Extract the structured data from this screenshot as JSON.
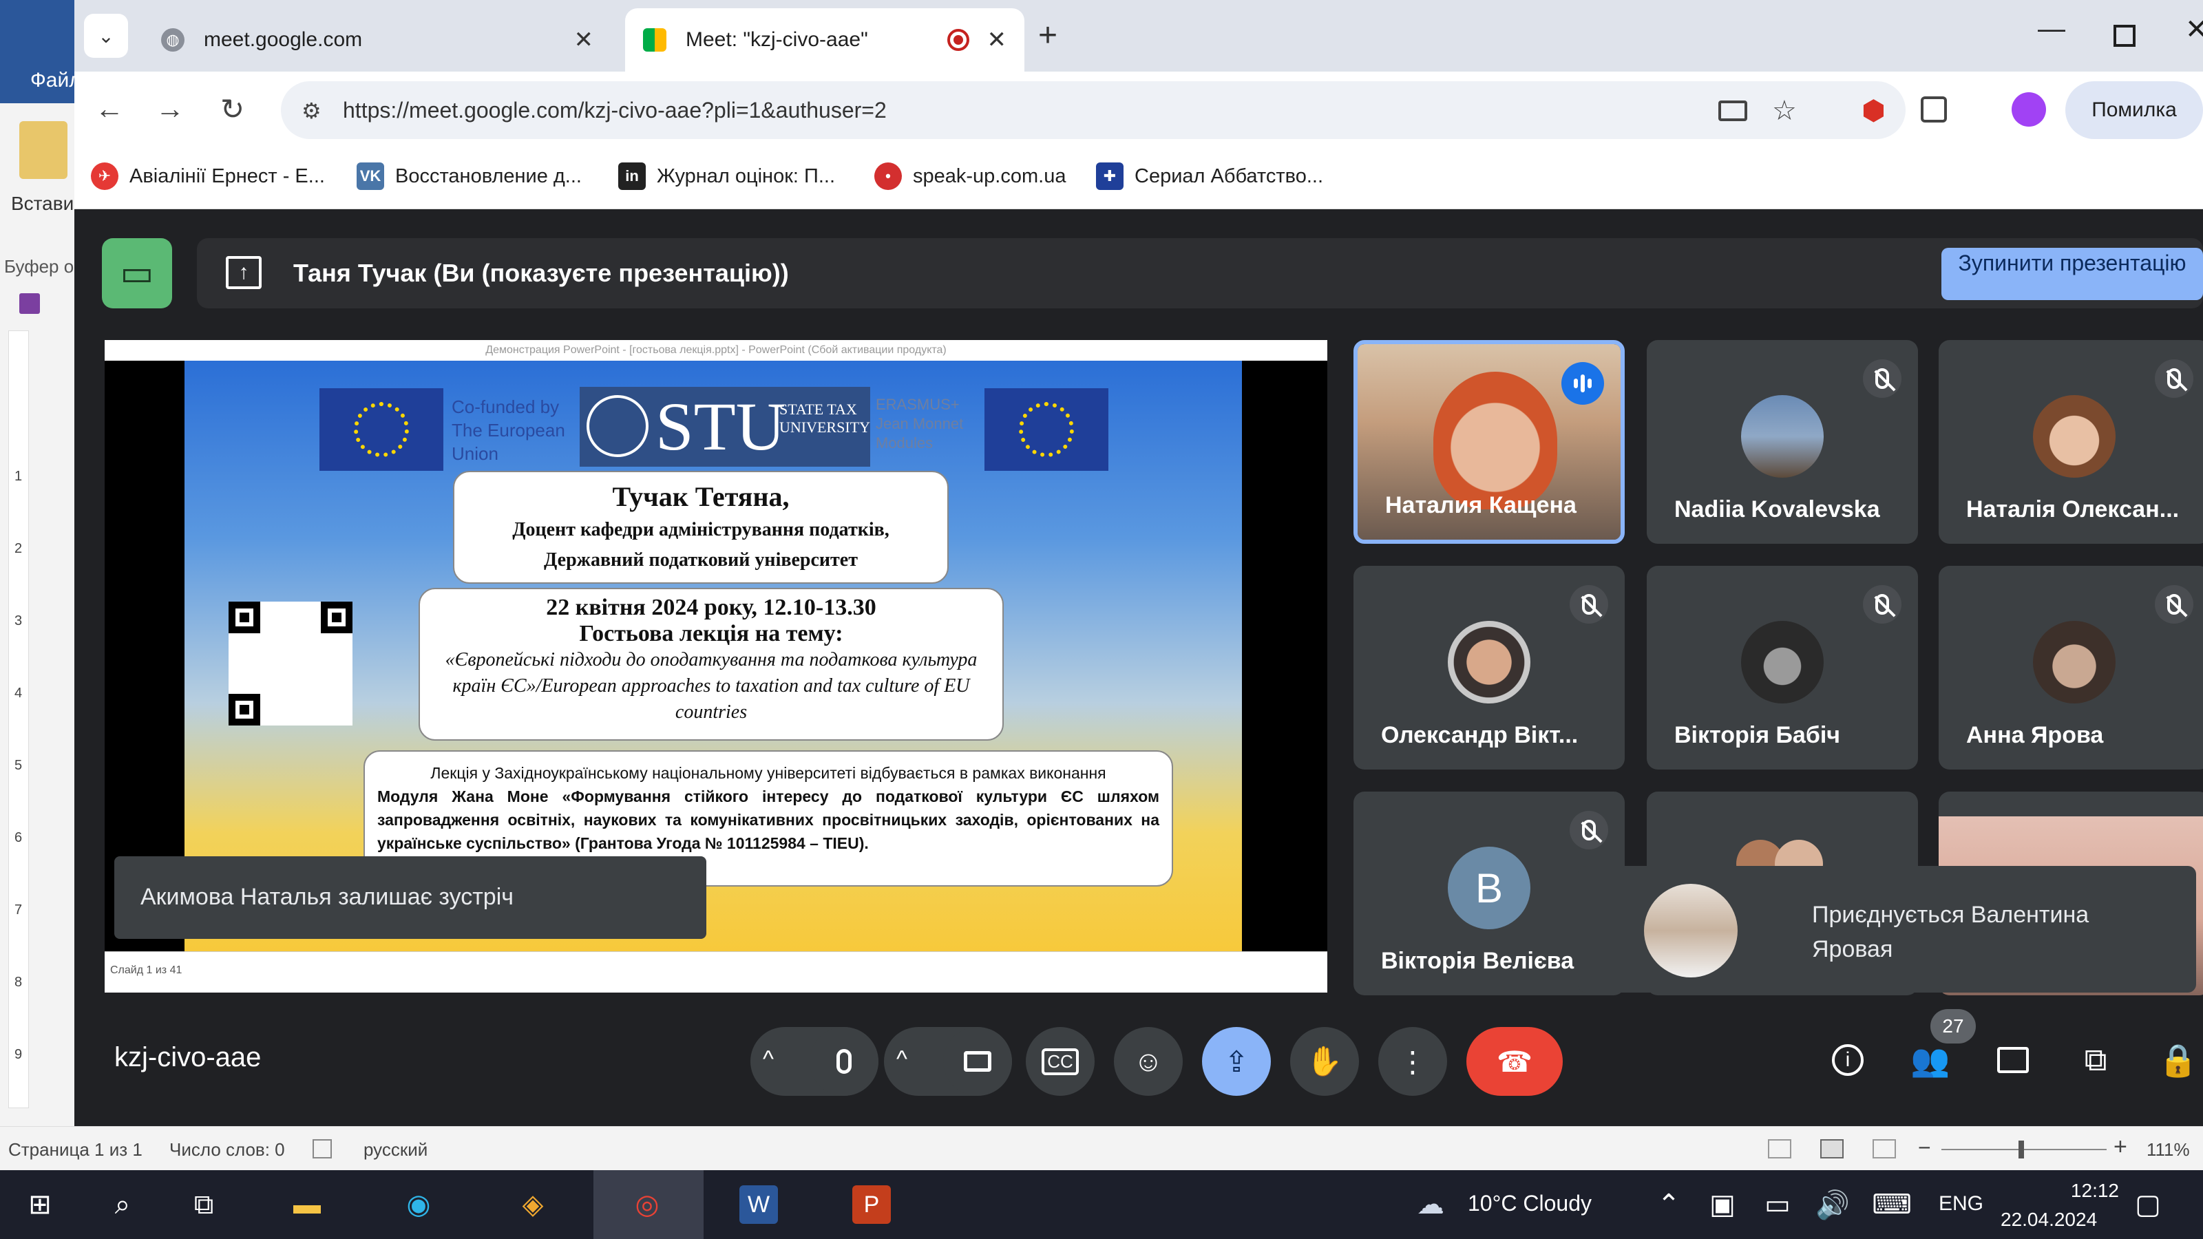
{
  "word": {
    "file_label": "Файл",
    "paste_label": "Встави",
    "buffer_label": "Буфер о",
    "ruler_numbers": [
      "1",
      "2",
      "3",
      "4",
      "5",
      "6",
      "7",
      "8",
      "9"
    ],
    "status": {
      "page": "Страница 1 из 1",
      "words": "Число слов: 0",
      "language": "русский",
      "zoom": "111%"
    }
  },
  "chrome": {
    "tabs": [
      {
        "title": "meet.google.com",
        "active": false
      },
      {
        "title": "Meet: \"kzj-civo-aae\"",
        "active": true
      }
    ],
    "url": "https://meet.google.com/kzj-civo-aae?pli=1&authuser=2",
    "profile_label": "Помилка",
    "bookmarks": [
      {
        "label": "Авіалінії Ернест - Е...",
        "color": "#e53935",
        "glyph": "✈"
      },
      {
        "label": "Восстановление д...",
        "color": "#4a76a8",
        "glyph": "VK"
      },
      {
        "label": "Журнал оцінок: П...",
        "color": "#222222",
        "glyph": "in"
      },
      {
        "label": "speak-up.com.ua",
        "color": "#d32f2f",
        "glyph": "•"
      },
      {
        "label": "Сериал Аббатство...",
        "color": "#1f3f99",
        "glyph": "✚"
      }
    ]
  },
  "meet": {
    "presenter_text": "Таня Тучак (Ви (показуєте презентацію))",
    "stop_button": "Зупинити презентацію",
    "meeting_code": "kzj-civo-aae",
    "participant_count": "27",
    "leave_toast": "Акимова Наталья залишає зустріч",
    "join_toast": "Приєднується Валентина Яровая",
    "tiles": [
      {
        "name": "Наталия Кащена",
        "speaking": true
      },
      {
        "name": "Nadiia Kovalevska",
        "speaking": false
      },
      {
        "name": "Наталія Олексан...",
        "speaking": false
      },
      {
        "name": "Олександр Вікт...",
        "speaking": false
      },
      {
        "name": "Вікторія Бабіч",
        "speaking": false
      },
      {
        "name": "Анна Ярова",
        "speaking": false
      },
      {
        "name": "Вікторія Велієва",
        "speaking": false,
        "initial": "В"
      }
    ]
  },
  "presentation": {
    "window_title": "Демонстрация PowerPoint - [гостьова лекція.pptx] - PowerPoint (Сбой активации продукта)",
    "slide_counter": "Слайд 1 из 41",
    "cofunded": "Co-funded by The European Union",
    "stu": "STU",
    "stu_sub": "STATE TAX UNIVERSITY",
    "erasmus": "ERASMUS+ Jean Monnet Modules",
    "name": "Тучак Тетяна,",
    "position_line1": "Доцент кафедри адміністрування податків,",
    "position_line2": "Державний податковий університет",
    "date": "22 квітня 2024 року, 12.10-13.30",
    "lecture": "Гостьова лекція на тему:",
    "topic": "«Європейські підходи до оподаткування та податкова культура країн ЄС»/European approaches to taxation and tax culture of EU countries",
    "info_line1": "Лекція у Західноукраїнському національному університеті відбувається в рамках виконання",
    "info_bold": "Модуля Жана Моне «Формування стійкого інтересу до податкової культури ЄС шляхом запровадження освітніх, наукових та комунікативних просвітницьких заходів, орієнтованих на українське суспільство» (Грантова Угода № 101125984 – TIEU)."
  },
  "taskbar": {
    "weather": "10°C  Cloudy",
    "lang": "ENG",
    "time": "12:12",
    "date": "22.04.2024"
  },
  "colors": {
    "meet_bg": "#202124",
    "tile_bg": "#3c4043",
    "accent_blue": "#8ab4f8",
    "end_call_red": "#ea4335",
    "device_green": "#5bb974"
  }
}
